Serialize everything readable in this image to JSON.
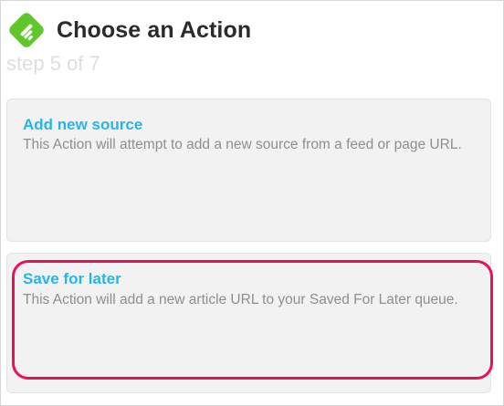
{
  "header": {
    "title": "Choose an Action",
    "step": "step 5 of 7",
    "logo_icon": "feedly-logo-icon"
  },
  "actions": [
    {
      "title": "Add new source",
      "description": "This Action will attempt to add a new source from a feed or page URL."
    },
    {
      "title": "Save for later",
      "description": "This Action will add a new article URL to your Saved For Later queue.",
      "highlighted": true
    }
  ],
  "colors": {
    "logo_green": "#5fc62b",
    "title_text": "#2b2b2b",
    "step_text": "#dedede",
    "action_title": "#27b5e9",
    "action_desc": "#8e8e8e",
    "card_bg": "#f2f2f2",
    "highlight": "#e8125a"
  }
}
